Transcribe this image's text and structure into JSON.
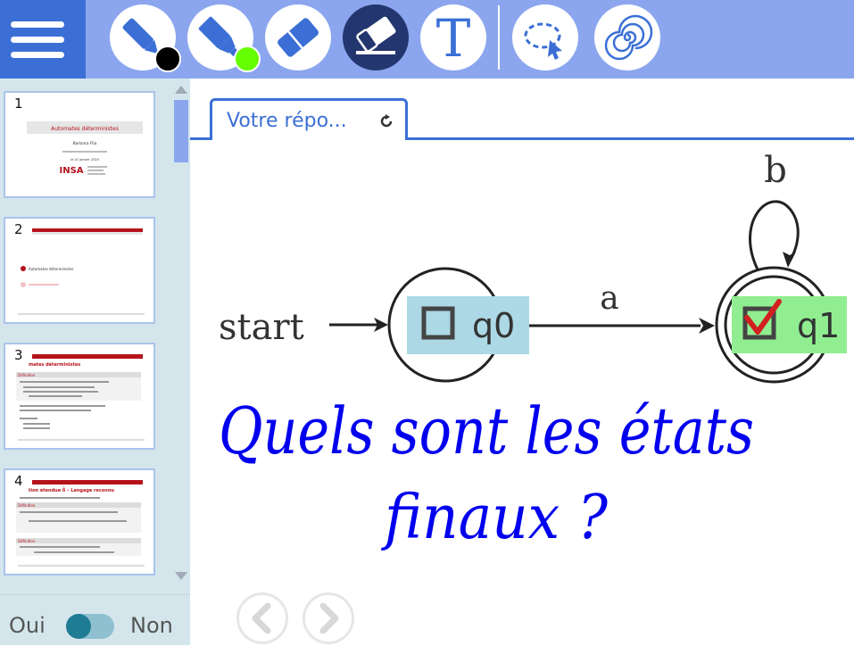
{
  "toolbar": {
    "tools": [
      {
        "name": "pen",
        "icon": "pen-icon",
        "dot_color": "#000000"
      },
      {
        "name": "highlighter",
        "icon": "highlighter-icon",
        "dot_color": "#66ff00"
      },
      {
        "name": "eraser-block",
        "icon": "eraser-block-icon"
      },
      {
        "name": "eraser",
        "icon": "eraser-icon",
        "active": true
      },
      {
        "name": "text",
        "icon": "text-icon",
        "label": "T"
      },
      {
        "name": "lasso",
        "icon": "lasso-select-icon"
      },
      {
        "name": "spiral",
        "icon": "spiral-icon"
      }
    ],
    "colors": {
      "bar": "#8ba6ee",
      "menu": "#3b6fd6",
      "active": "#24366f",
      "icon": "#3b6fd6"
    }
  },
  "sidebar": {
    "slides": [
      {
        "number": "1",
        "title": "Automates déterministes",
        "author": "Barbara Fila",
        "date": "le 20 janvier 2020",
        "logo": "INSA"
      },
      {
        "number": "2",
        "item": "Automates déterministes"
      },
      {
        "number": "3",
        "title": "mates déterministes",
        "heading": "Définition"
      },
      {
        "number": "4",
        "title": "tion étendue δ̂ – Langage reconnu",
        "heading": "Définition"
      }
    ],
    "toggle": {
      "left_label": "Oui",
      "right_label": "Non"
    }
  },
  "main": {
    "tab": {
      "label": "Votre répo..."
    },
    "diagram": {
      "start_label": "start",
      "states": [
        {
          "name": "q0",
          "final": false,
          "label_bg": "#add8e6"
        },
        {
          "name": "q1",
          "final": true,
          "label_bg": "#90ee90"
        }
      ],
      "transitions": [
        {
          "from": "q0",
          "to": "q1",
          "label": "a"
        },
        {
          "from": "q1",
          "to": "q1",
          "label": "b"
        }
      ]
    },
    "handwriting": {
      "line1": "Quels sont les états",
      "line2": "finaux ?",
      "color": "#0000ee"
    },
    "nav": {
      "prev": "chevron-left-icon",
      "next": "chevron-right-icon"
    }
  }
}
